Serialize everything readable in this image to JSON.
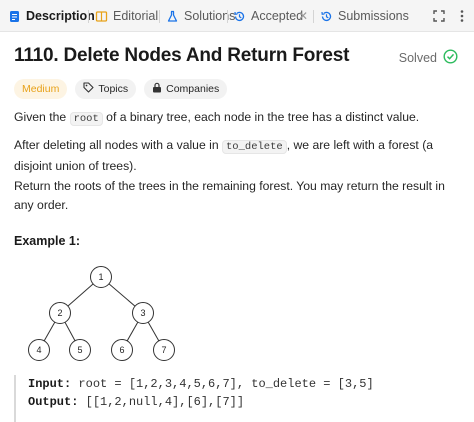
{
  "tabs": [
    {
      "label": "Description",
      "icon": "document-icon",
      "active": true
    },
    {
      "label": "Editorial",
      "icon": "book-icon",
      "active": false
    },
    {
      "label": "Solutions",
      "icon": "flask-icon",
      "active": false
    },
    {
      "label": "Accepted",
      "icon": "history-icon",
      "active": false
    },
    {
      "label": "Submissions",
      "icon": "history-icon",
      "active": false
    }
  ],
  "problem": {
    "title": "1110. Delete Nodes And Return Forest",
    "status": "Solved",
    "difficulty": "Medium",
    "topics_label": "Topics",
    "companies_label": "Companies"
  },
  "description": {
    "p1_a": "Given the ",
    "p1_code": "root",
    "p1_b": " of a binary tree, each node in the tree has a distinct value.",
    "p2_a": "After deleting all nodes with a value in ",
    "p2_code": "to_delete",
    "p2_b": ", we are left with a forest (a disjoint union of trees).",
    "p3": "Return the roots of the trees in the remaining forest. You may return the result in any order."
  },
  "example": {
    "title": "Example 1:",
    "tree_nodes": [
      "1",
      "2",
      "3",
      "4",
      "5",
      "6",
      "7"
    ],
    "input_label": "Input:",
    "input_value": " root = [1,2,3,4,5,6,7], to_delete = [3,5]",
    "output_label": "Output:",
    "output_value": " [[1,2,null,4],[6],[7]]"
  },
  "colors": {
    "accent_medium": "#e8a21a",
    "tab_active_icon": "#1a73e8",
    "editorial_icon": "#e8a21a",
    "solutions_icon": "#1a73e8",
    "submissions_icon": "#1a73e8"
  }
}
